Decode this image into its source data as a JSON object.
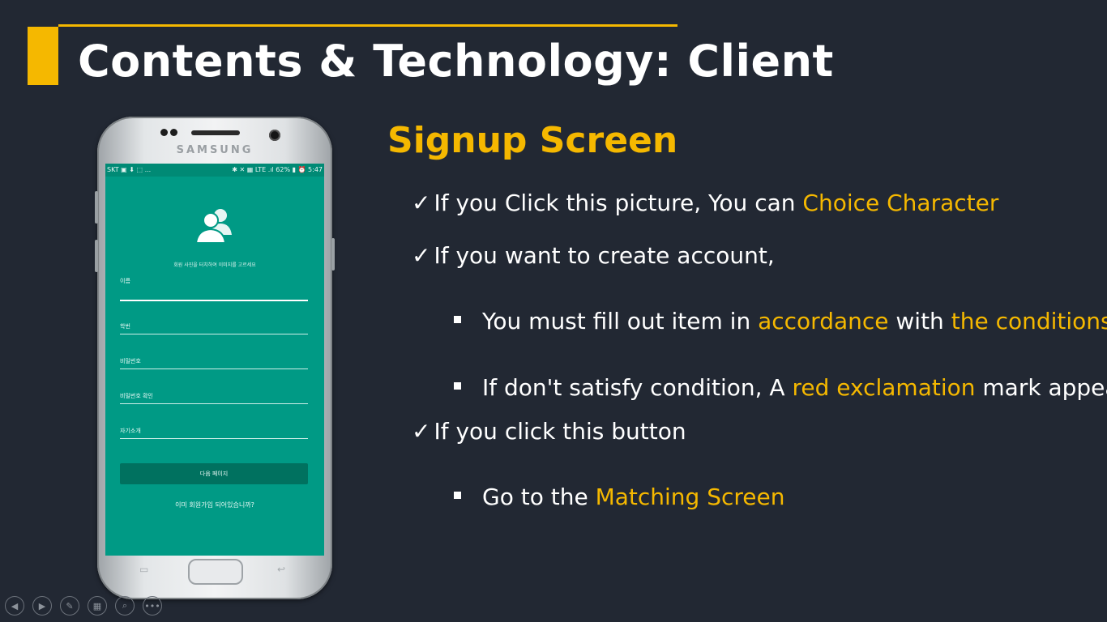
{
  "slide": {
    "title": "Contents & Technology: Client"
  },
  "phone": {
    "brand": "SAMSUNG",
    "status_left": "SKT ▣ ⬇ ⬚ ...",
    "status_right": "✱ ✕ ▦ LTE .ıl 62% ▮ ⏰ 5:47",
    "photo_hint": "회원 사진을 터치하여 이미지를 고르세요",
    "fields": [
      "이름",
      "학번",
      "비밀번호",
      "비밀번호 확인",
      "자기소개"
    ],
    "next_button": "다음 페이지",
    "login_link": "이미 회원가입 되어있습니까?",
    "nav_left_glyph": "▭",
    "nav_right_glyph": "↩"
  },
  "content": {
    "section_title": "Signup Screen",
    "line1": {
      "check": "✓",
      "text": "If you Click this picture,  You can ",
      "highlight": "Choice Character"
    },
    "line2": {
      "check": "✓",
      "text": "If you want to create account,"
    },
    "bullet1": {
      "a": "You must fill out item in ",
      "h1": "accordance",
      "b": " with ",
      "h2": "the conditions",
      "c": "."
    },
    "bullet2": {
      "a": "If don't satisfy condition, A ",
      "h1": "red exclamation",
      "b": " mark appears."
    },
    "line3": {
      "check": "✓",
      "text": "If you click this button"
    },
    "bullet3": {
      "a": "Go to the ",
      "h1": "Matching Screen"
    }
  },
  "toolbar": {
    "icons": [
      "prev-icon",
      "next-icon",
      "pen-icon",
      "slides-icon",
      "zoom-icon",
      "more-icon"
    ],
    "glyphs": [
      "◀",
      "▶",
      "✎",
      "▦",
      "⌕",
      "•••"
    ]
  },
  "colors": {
    "accent": "#f5b800",
    "background": "#222833",
    "app_teal": "#009a85"
  }
}
